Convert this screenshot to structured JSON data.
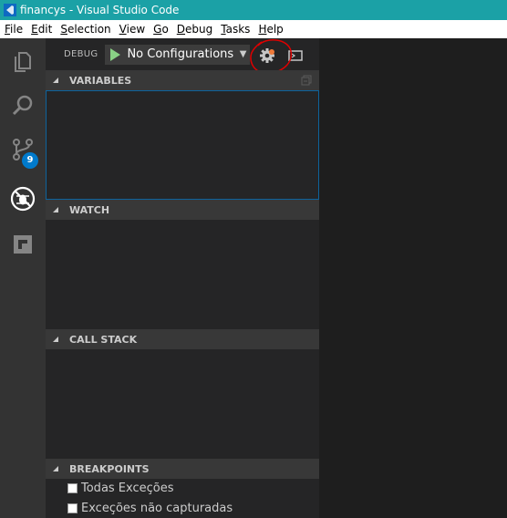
{
  "window": {
    "title": "financys - Visual Studio Code"
  },
  "menu": {
    "items": [
      {
        "pre": "",
        "ul": "F",
        "post": "ile"
      },
      {
        "pre": "",
        "ul": "E",
        "post": "dit"
      },
      {
        "pre": "",
        "ul": "S",
        "post": "election"
      },
      {
        "pre": "",
        "ul": "V",
        "post": "iew"
      },
      {
        "pre": "",
        "ul": "G",
        "post": "o"
      },
      {
        "pre": "",
        "ul": "D",
        "post": "ebug"
      },
      {
        "pre": "",
        "ul": "T",
        "post": "asks"
      },
      {
        "pre": "",
        "ul": "H",
        "post": "elp"
      }
    ]
  },
  "activity_bar": {
    "icons": [
      "explorer-icon",
      "search-icon",
      "source-control-icon",
      "debug-icon",
      "extensions-icon"
    ],
    "scm_badge": "9"
  },
  "debug_toolbar": {
    "label": "DEBUG",
    "configuration": "No Configurations",
    "colors": {
      "play": "#89d185",
      "gear_indicator": "#f07a3a",
      "annotation": "#e00000"
    }
  },
  "sections": {
    "variables": "VARIABLES",
    "watch": "WATCH",
    "call_stack": "CALL STACK",
    "breakpoints": "BREAKPOINTS"
  },
  "breakpoints": {
    "items": [
      {
        "label": "Todas Exceções",
        "checked": false
      },
      {
        "label": "Exceções não capturadas",
        "checked": false
      }
    ]
  },
  "colors": {
    "titlebar": "#1ba1a6",
    "activity_bar": "#333333",
    "sidebar": "#252526",
    "section_header": "#383838",
    "badge": "#007acc"
  }
}
